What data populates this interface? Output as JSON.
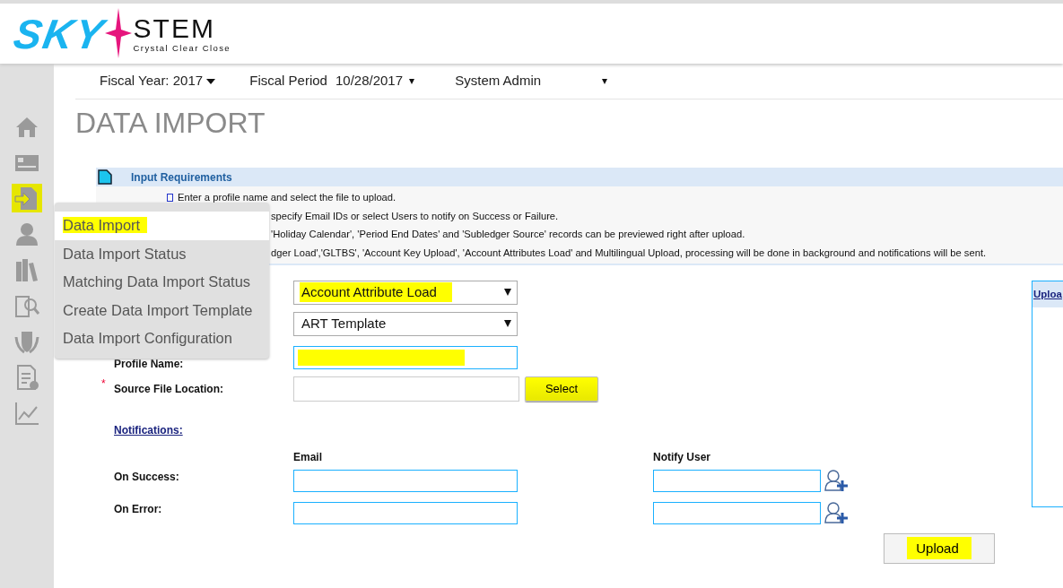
{
  "logo": {
    "brand_start": "SKY",
    "brand_end": "STEM",
    "tagline": "Crystal Clear Close"
  },
  "sidebar": {
    "items": [
      {
        "kind": "home",
        "highlighted": false
      },
      {
        "kind": "card",
        "highlighted": false
      },
      {
        "kind": "import",
        "highlighted": true
      },
      {
        "kind": "user",
        "highlighted": false
      },
      {
        "kind": "books",
        "highlighted": false
      },
      {
        "kind": "report",
        "highlighted": false
      },
      {
        "kind": "shield",
        "highlighted": false
      },
      {
        "kind": "document",
        "highlighted": false
      },
      {
        "kind": "chart",
        "highlighted": false
      }
    ]
  },
  "top_bar": {
    "fiscal_year": "Fiscal Year: 2017",
    "fiscal_period_label": "Fiscal Period",
    "fiscal_period": "10/28/2017",
    "role": "System Admin"
  },
  "title": "DATA IMPORT",
  "requirements": {
    "title": "Input Requirements",
    "lines": [
      {
        "bullet": true,
        "text": "Enter a profile name and select the file to upload."
      },
      {
        "bullet": false,
        "text": "specify Email IDs or select Users to notify on Success or Failure."
      },
      {
        "bullet": false,
        "text": "'Holiday Calendar', 'Period End Dates' and 'Subledger Source' records can be previewed right after upload."
      },
      {
        "bullet": false,
        "text": "dger Load','GLTBS', 'Account Key Upload', 'Account Attributes Load' and Multilingual Upload, processing will be done in background and notifications will be sent."
      }
    ]
  },
  "menu": {
    "items": [
      {
        "label": "Data Import",
        "selected": true,
        "highlighted": true
      },
      {
        "label": "Data Import Status",
        "selected": false,
        "highlighted": false
      },
      {
        "label": "Matching Data Import Status",
        "selected": false,
        "highlighted": false
      },
      {
        "label": "Create Data Import Template",
        "selected": false,
        "highlighted": false
      },
      {
        "label": "Data Import Configuration",
        "selected": false,
        "highlighted": false
      }
    ]
  },
  "form": {
    "fields": [
      {
        "kind": "select",
        "value": "Account Attribute Load",
        "highlighted": true
      },
      {
        "kind": "select",
        "value": "ART Template",
        "highlighted": false
      },
      {
        "kind": "text",
        "label": "Profile Name:",
        "highlighted": true
      },
      {
        "kind": "file",
        "label": "Source File Location:",
        "required_mark": "*",
        "button": "Select",
        "highlighted": true
      }
    ]
  },
  "notifications": {
    "link": "Notifications:",
    "columns": [
      "Email",
      "Notify User"
    ],
    "rows": [
      {
        "label": "On Success:"
      },
      {
        "label": "On Error:"
      }
    ]
  },
  "upload_button": {
    "label": "Upload",
    "highlighted": true
  },
  "upload_panel": {
    "title": "Uploa"
  }
}
